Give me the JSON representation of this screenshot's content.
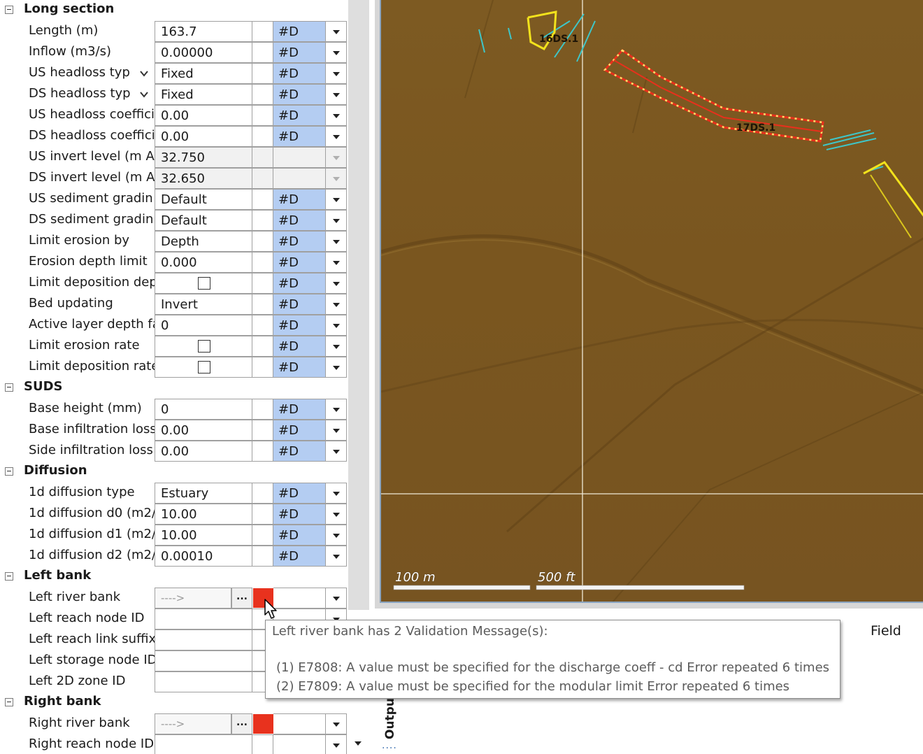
{
  "sections": [
    {
      "label": "Long section",
      "rows": [
        {
          "label": "Length (m)",
          "value": "163.7",
          "d": "#D"
        },
        {
          "label": "Inflow (m3/s)",
          "value": "0.00000",
          "d": "#D"
        },
        {
          "label": "US headloss typ",
          "value": "Fixed",
          "d": "#D",
          "chev": true
        },
        {
          "label": "DS headloss typ",
          "value": "Fixed",
          "d": "#D",
          "chev": true
        },
        {
          "label": "US headloss coeffici",
          "value": "0.00",
          "d": "#D"
        },
        {
          "label": "DS headloss coeffici",
          "value": "0.00",
          "d": "#D"
        },
        {
          "label": "US invert level (m AD",
          "value": "32.750",
          "d": "",
          "ro": true
        },
        {
          "label": "DS invert level (m AD",
          "value": "32.650",
          "d": "",
          "ro": true
        },
        {
          "label": "US sediment gradin",
          "value": "Default",
          "d": "#D"
        },
        {
          "label": "DS sediment gradin",
          "value": "Default",
          "d": "#D"
        },
        {
          "label": "Limit erosion by",
          "value": "Depth",
          "d": "#D"
        },
        {
          "label": "Erosion depth limit",
          "value": "0.000",
          "d": "#D"
        },
        {
          "label": "Limit deposition dep",
          "checkbox": true,
          "d": "#D"
        },
        {
          "label": "Bed updating",
          "value": "Invert",
          "d": "#D"
        },
        {
          "label": "Active layer depth fa",
          "value": "0",
          "d": "#D"
        },
        {
          "label": "Limit erosion rate",
          "checkbox": true,
          "d": "#D"
        },
        {
          "label": "Limit deposition rate",
          "checkbox": true,
          "d": "#D"
        }
      ]
    },
    {
      "label": "SUDS",
      "rows": [
        {
          "label": "Base height (mm)",
          "value": "0",
          "d": "#D"
        },
        {
          "label": "Base infiltration loss",
          "value": "0.00",
          "d": "#D"
        },
        {
          "label": "Side infiltration loss",
          "value": "0.00",
          "d": "#D"
        }
      ]
    },
    {
      "label": "Diffusion",
      "rows": [
        {
          "label": "1d diffusion type",
          "value": "Estuary",
          "d": "#D"
        },
        {
          "label": "1d diffusion d0 (m2/",
          "value": "10.00",
          "d": "#D"
        },
        {
          "label": "1d diffusion d1 (m2/",
          "value": "10.00",
          "d": "#D"
        },
        {
          "label": "1d diffusion d2 (m2/",
          "value": "0.00010",
          "d": "#D"
        }
      ]
    },
    {
      "label": "Left bank",
      "rows": [
        {
          "label": "Left river bank",
          "link": "---->",
          "ellipsis": "...",
          "flag": true
        },
        {
          "label": "Left reach node ID",
          "empty": true
        },
        {
          "label": "Left reach link suffix",
          "empty": true
        },
        {
          "label": "Left storage node ID",
          "empty": true
        },
        {
          "label": "Left 2D zone ID",
          "empty": true
        }
      ]
    },
    {
      "label": "Right bank",
      "rows": [
        {
          "label": "Right river bank",
          "link": "---->",
          "ellipsis": "...",
          "flag": true
        },
        {
          "label": "Right reach node ID",
          "empty": true
        }
      ]
    }
  ],
  "map": {
    "labels": [
      "16DS.1",
      "17DS.1"
    ],
    "scale": [
      "100 m",
      "500 ft"
    ]
  },
  "lower_panel": {
    "tab": "Outpu",
    "field_header": "Field",
    "dots": "...."
  },
  "tooltip": {
    "title": "Left river bank has 2 Validation Message(s):",
    "messages": [
      "(1) E7808: A value must be specified for the discharge coeff - cd Error repeated 6 times",
      "(2) E7809: A value must be specified for the modular limit Error repeated 6 times"
    ]
  },
  "colors": {
    "highlight": "#b4cdf2",
    "flag": "#e8321e",
    "terrain": "#7b5820",
    "section_selected": "#e8301c",
    "section_other": "#f2e21c"
  }
}
